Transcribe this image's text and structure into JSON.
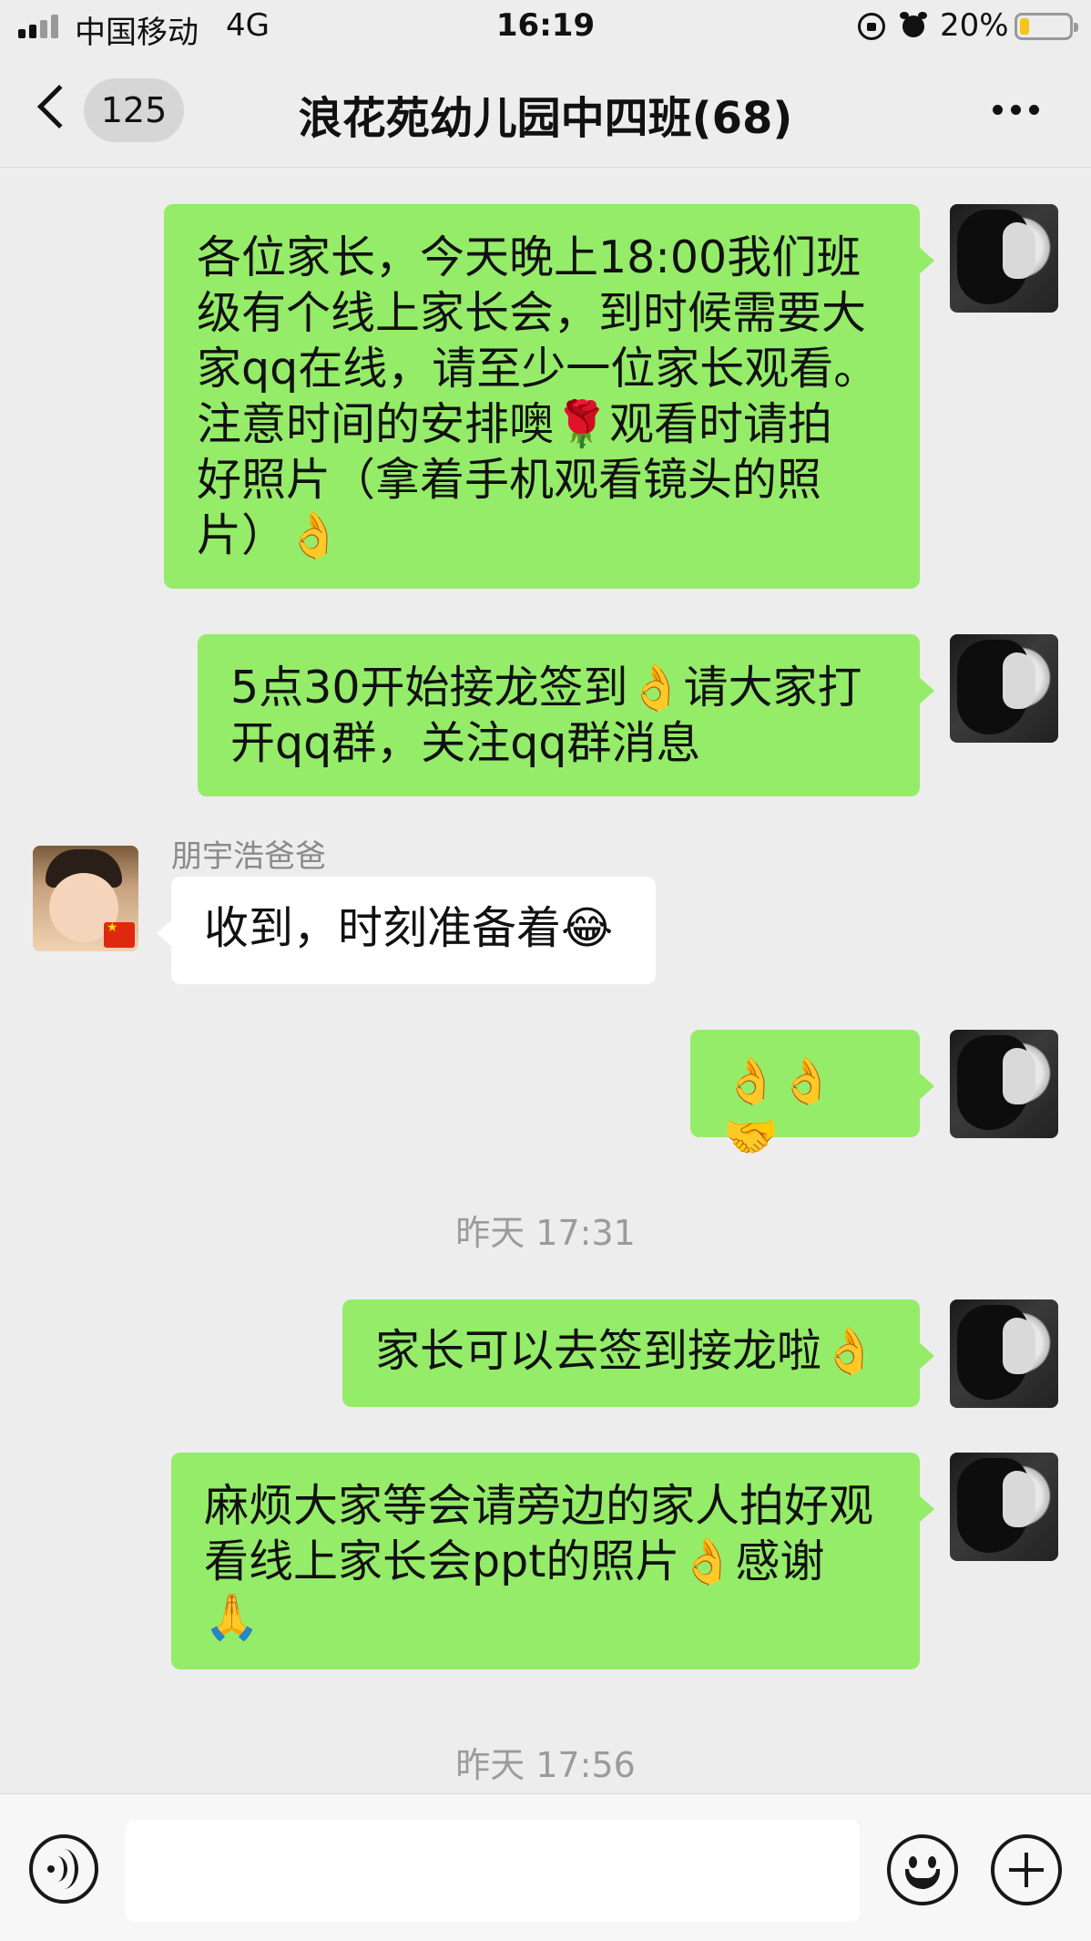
{
  "status_bar": {
    "carrier": "中国移动",
    "network": "4G",
    "time": "16:19",
    "battery_percent": "20%",
    "battery_level": 0.2,
    "icons": [
      "signal-icon",
      "rotation-lock-icon",
      "alarm-icon",
      "battery-icon"
    ]
  },
  "header": {
    "unread_count": "125",
    "title": "浪花苑幼儿园中四班(68)",
    "icons": [
      "back-icon",
      "more-icon"
    ]
  },
  "messages": [
    {
      "sender": "me",
      "text": "各位家长，今天晚上18:00我们班\n级有个线上家长会，到时候需要大\n家qq在线，请至少一位家长观看。\n注意时间的安排噢🌹观看时请拍\n好照片（拿着手机观看镜头的照\n片）👌"
    },
    {
      "sender": "me",
      "text": "5点30开始接龙签到👌请大家打\n开qq群，关注qq群消息"
    },
    {
      "sender": "other",
      "name": "朋宇浩爸爸",
      "text": "收到，时刻准备着😂"
    },
    {
      "sender": "me",
      "text": "👌👌🤝"
    },
    {
      "sender": "me",
      "text": "家长可以去签到接龙啦👌"
    },
    {
      "sender": "me",
      "text": "麻烦大家等会请旁边的家人拍好观\n看线上家长会ppt的照片👌感谢\n🙏"
    }
  ],
  "timestamps": [
    "昨天 17:31",
    "昨天 17:56"
  ],
  "input_bar": {
    "placeholder": "",
    "icons": [
      "voice-icon",
      "emoji-icon",
      "plus-icon"
    ]
  },
  "colors": {
    "background": "#ededed",
    "my_bubble": "#95ec69",
    "other_bubble": "#ffffff",
    "timestamp": "#9b9b9b"
  }
}
